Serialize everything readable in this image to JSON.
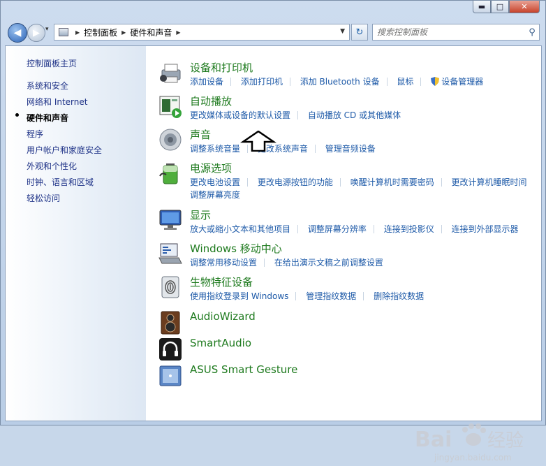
{
  "window": {
    "controls": {
      "minimize": "▬",
      "maximize": "□",
      "close": "✕"
    }
  },
  "nav": {
    "back_icon": "◀",
    "forward_icon": "▶",
    "recent_icon": "▾",
    "breadcrumb": [
      "控制面板",
      "硬件和声音"
    ],
    "search_placeholder": "搜索控制面板",
    "refresh_icon": "↻",
    "search_icon": "⚲"
  },
  "sidebar": {
    "home": "控制面板主页",
    "items": [
      {
        "label": "系统和安全",
        "active": false
      },
      {
        "label": "网络和 Internet",
        "active": false
      },
      {
        "label": "硬件和声音",
        "active": true
      },
      {
        "label": "程序",
        "active": false
      },
      {
        "label": "用户帐户和家庭安全",
        "active": false
      },
      {
        "label": "外观和个性化",
        "active": false
      },
      {
        "label": "时钟、语言和区域",
        "active": false
      },
      {
        "label": "轻松访问",
        "active": false
      }
    ]
  },
  "categories": [
    {
      "title": "设备和打印机",
      "icon": "printer-icon",
      "links": [
        "添加设备",
        "添加打印机",
        "添加 Bluetooth 设备",
        "鼠标",
        "设备管理器"
      ]
    },
    {
      "title": "自动播放",
      "icon": "autoplay-icon",
      "links": [
        "更改媒体或设备的默认设置",
        "自动播放 CD 或其他媒体"
      ]
    },
    {
      "title": "声音",
      "icon": "speaker-icon",
      "links": [
        "调整系统音量",
        "更改系统声音",
        "管理音频设备"
      ]
    },
    {
      "title": "电源选项",
      "icon": "battery-icon",
      "links": [
        "更改电池设置",
        "更改电源按钮的功能",
        "唤醒计算机时需要密码",
        "更改计算机睡眠时间"
      ],
      "links2": [
        "调整屏幕亮度"
      ]
    },
    {
      "title": "显示",
      "icon": "monitor-icon",
      "links": [
        "放大或缩小文本和其他项目",
        "调整屏幕分辨率",
        "连接到投影仪",
        "连接到外部显示器"
      ]
    },
    {
      "title": "Windows 移动中心",
      "icon": "mobility-center-icon",
      "links": [
        "调整常用移动设置",
        "在给出演示文稿之前调整设置"
      ]
    },
    {
      "title": "生物特征设备",
      "icon": "fingerprint-icon",
      "links": [
        "使用指纹登录到 Windows",
        "管理指纹数据",
        "删除指纹数据"
      ]
    },
    {
      "title": "AudioWizard",
      "icon": "audiowizard-icon",
      "links": []
    },
    {
      "title": "SmartAudio",
      "icon": "headphones-icon",
      "links": []
    },
    {
      "title": "ASUS Smart Gesture",
      "icon": "touchpad-icon",
      "links": []
    }
  ],
  "watermark": {
    "brand": "Bai",
    "brand_suffix": "经验",
    "url": "jingyan.baidu.com"
  },
  "colors": {
    "category_title": "#1e7a1e",
    "link": "#1e5aa8",
    "nav_link": "#1e3287",
    "close_button": "#c7432b"
  }
}
